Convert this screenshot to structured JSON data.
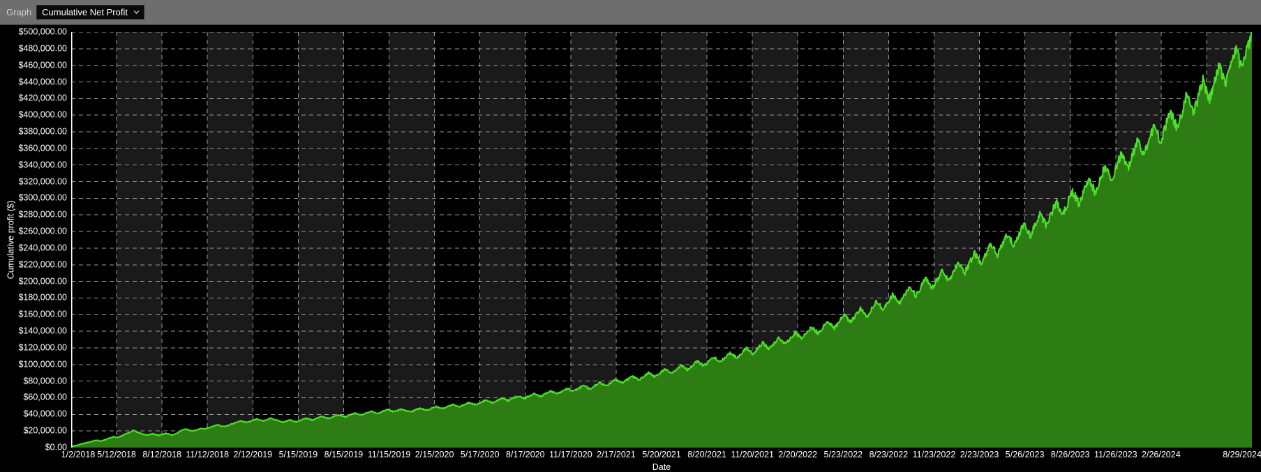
{
  "toolbar": {
    "graph_label": "Graph",
    "selected_graph": "Cumulative Net Profit",
    "dropdown_icon": "chevron-down-icon"
  },
  "chart_data": {
    "type": "area",
    "title": "Cumulative Net Profit",
    "xlabel": "Date",
    "ylabel": "Cumulative profit ($)",
    "grid": true,
    "legend": "none",
    "line_color": "#4CE029",
    "fill_color": "#2E7D14",
    "plot_background": "#000000",
    "band_color": "#1a1a1a",
    "gridline_color": "#9a9a9a",
    "ylim": [
      0,
      500000
    ],
    "ytick_step": 20000,
    "ytick_labels": [
      "$500,000.00",
      "$480,000.00",
      "$460,000.00",
      "$440,000.00",
      "$420,000.00",
      "$400,000.00",
      "$380,000.00",
      "$360,000.00",
      "$340,000.00",
      "$320,000.00",
      "$300,000.00",
      "$280,000.00",
      "$260,000.00",
      "$240,000.00",
      "$220,000.00",
      "$200,000.00",
      "$180,000.00",
      "$160,000.00",
      "$140,000.00",
      "$120,000.00",
      "$100,000.00",
      "$80,000.00",
      "$60,000.00",
      "$40,000.00",
      "$20,000.00",
      "$0.00"
    ],
    "ytick_values": [
      500000,
      480000,
      460000,
      440000,
      420000,
      400000,
      380000,
      360000,
      340000,
      320000,
      300000,
      280000,
      260000,
      240000,
      220000,
      200000,
      180000,
      160000,
      140000,
      120000,
      100000,
      80000,
      60000,
      40000,
      20000,
      0
    ],
    "xtick_labels": [
      "1/2/2018",
      "5/12/2018",
      "8/12/2018",
      "11/12/2018",
      "2/12/2019",
      "5/15/2019",
      "8/15/2019",
      "11/15/2019",
      "2/15/2020",
      "5/17/2020",
      "8/17/2020",
      "11/17/2020",
      "2/17/2021",
      "5/20/2021",
      "8/20/2021",
      "11/20/2021",
      "2/20/2022",
      "5/23/2022",
      "8/23/2022",
      "11/23/2022",
      "2/23/2023",
      "5/26/2023",
      "8/26/2023",
      "11/26/2023",
      "2/26/2024",
      "",
      "8/29/2024"
    ],
    "series": [
      {
        "name": "Cumulative Net Profit",
        "x_start": "1/2/2018",
        "x_end": "8/29/2024",
        "final_value": 497000,
        "values": [
          1200,
          2100,
          3000,
          4200,
          5400,
          6100,
          7000,
          8200,
          9000,
          7600,
          8900,
          10400,
          11800,
          13100,
          12000,
          13400,
          15200,
          16900,
          18400,
          20900,
          19100,
          17600,
          16200,
          14900,
          15600,
          16800,
          15400,
          14700,
          15900,
          17100,
          16300,
          15200,
          16400,
          18600,
          20900,
          22300,
          21100,
          19800,
          20600,
          21900,
          23100,
          22400,
          23800,
          25100,
          26400,
          27200,
          26100,
          25300,
          26700,
          28100,
          29400,
          30900,
          32200,
          31100,
          30200,
          31600,
          33100,
          34500,
          33200,
          32100,
          33600,
          35200,
          34300,
          33100,
          31800,
          30600,
          31900,
          33400,
          32200,
          31000,
          32400,
          34100,
          35600,
          34200,
          33000,
          34600,
          36200,
          37500,
          36200,
          35100,
          36600,
          38100,
          39400,
          38200,
          37000,
          38500,
          40100,
          41400,
          40200,
          39100,
          40600,
          42200,
          43500,
          42300,
          41100,
          42700,
          44200,
          45600,
          44300,
          43100,
          44700,
          46300,
          45100,
          43900,
          42600,
          44200,
          45900,
          47400,
          46100,
          44800,
          46400,
          48100,
          49600,
          48200,
          46900,
          48600,
          50300,
          51800,
          50400,
          49100,
          50800,
          52600,
          54200,
          52800,
          51400,
          53200,
          55100,
          56800,
          55300,
          53900,
          55800,
          57700,
          59400,
          57900,
          56400,
          58400,
          60400,
          62200,
          60600,
          59000,
          61100,
          63200,
          65100,
          63400,
          61700,
          63900,
          66100,
          68100,
          66300,
          64500,
          66800,
          69200,
          71300,
          69400,
          67500,
          69900,
          72400,
          74600,
          72600,
          70600,
          73200,
          75800,
          78200,
          76100,
          74000,
          76700,
          79500,
          82000,
          79800,
          77600,
          80400,
          83300,
          86000,
          83700,
          81300,
          84300,
          87300,
          90100,
          87700,
          85200,
          88300,
          91500,
          94400,
          91900,
          89300,
          92600,
          95900,
          99000,
          96300,
          93600,
          97100,
          100600,
          103900,
          101000,
          98200,
          101800,
          105500,
          109000,
          106000,
          103000,
          106800,
          110700,
          114300,
          111200,
          108000,
          112000,
          116100,
          119900,
          116600,
          113300,
          117500,
          121800,
          125800,
          122300,
          118900,
          123300,
          127800,
          132000,
          128400,
          124700,
          129300,
          134000,
          138400,
          134600,
          130800,
          135600,
          140600,
          145200,
          141200,
          137200,
          142300,
          147500,
          152300,
          148100,
          143900,
          149200,
          154700,
          159800,
          155300,
          151000,
          156500,
          162300,
          167600,
          163000,
          158300,
          164100,
          170200,
          175800,
          171000,
          166100,
          172200,
          178600,
          184500,
          179400,
          174300,
          180700,
          187300,
          193500,
          188200,
          182800,
          189500,
          196400,
          202900,
          197300,
          191700,
          198700,
          205900,
          212700,
          206900,
          201000,
          208300,
          215900,
          223000,
          216900,
          210700,
          218400,
          226300,
          233800,
          227400,
          220900,
          228900,
          237200,
          245100,
          238400,
          231600,
          240000,
          248700,
          256900,
          249900,
          242800,
          251600,
          260700,
          269300,
          262000,
          254500,
          263700,
          273200,
          282200,
          274500,
          266700,
          276300,
          286200,
          295600,
          287600,
          279400,
          289400,
          299700,
          309500,
          301200,
          292700,
          303100,
          313800,
          324100,
          315400,
          306600,
          317400,
          328600,
          339300,
          330200,
          321000,
          332300,
          343900,
          355000,
          345500,
          336000,
          347700,
          359700,
          371300,
          361400,
          351500,
          363600,
          376100,
          388100,
          377800,
          367500,
          380000,
          393000,
          405400,
          394700,
          384000,
          397000,
          410400,
          423300,
          412200,
          401000,
          414400,
          428300,
          441600,
          430100,
          418500,
          432400,
          446700,
          460500,
          448500,
          436500,
          450900,
          465700,
          480000,
          467600,
          455200,
          470100,
          485400,
          497000
        ]
      }
    ],
    "notes": {
      "shape": "steadily rising equity curve with periodic drawdowns; steepening growth after mid-2020",
      "band_shading": "alternating vertical bands between major x gridlines"
    }
  }
}
